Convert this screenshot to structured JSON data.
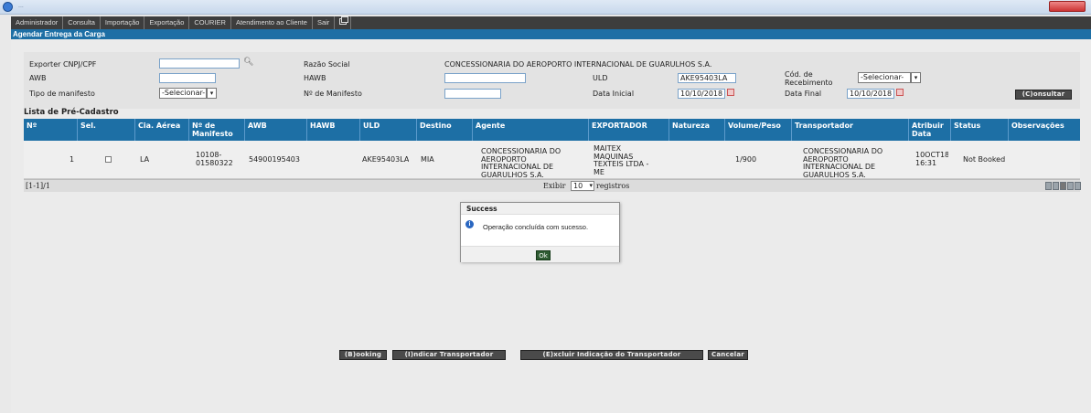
{
  "window": {
    "title": "...",
    "ie_icon": "internet-explorer-icon"
  },
  "menu": {
    "items": [
      "Administrador",
      "Consulta",
      "Importação",
      "Exportação",
      "COURIER",
      "Atendimento ao Cliente",
      "Sair"
    ],
    "extra_icon": "window-icon"
  },
  "page": {
    "title": "Agendar Entrega da Carga"
  },
  "form": {
    "exporter_label": "Exporter CNPJ/CPF",
    "exporter_value": "",
    "razao_label": "Razão Social",
    "razao_value": "CONCESSIONARIA DO AEROPORTO INTERNACIONAL DE GUARULHOS S.A.",
    "awb_label": "AWB",
    "awb_value": "",
    "hawb_label": "HAWB",
    "hawb_value": "",
    "uld_label": "ULD",
    "uld_value": "AKE95403LA",
    "cod_label_line1": "Cód. de",
    "cod_label_line2": "Recebimento",
    "cod_value": "-Selecionar-",
    "tipo_label": "Tipo de manifesto",
    "tipo_value": "-Selecionar-",
    "manifesto_label": "Nº de Manifesto",
    "manifesto_value": "",
    "data_inicial_label": "Data Inicial",
    "data_inicial_value": "10/10/2018",
    "data_final_label": "Data Final",
    "data_final_value": "10/10/2018",
    "consultar_label": "(C)onsultar"
  },
  "list": {
    "title": "Lista de Pré-Cadastro",
    "columns": [
      "Nº",
      "Sel.",
      "Cia. Aérea",
      "Nº de Manifesto",
      "AWB",
      "HAWB",
      "ULD",
      "Destino",
      "Agente",
      "EXPORTADOR",
      "Natureza",
      "Volume/Peso",
      "Transportador",
      "Atribuir Data",
      "Status",
      "Observações"
    ],
    "rows": [
      {
        "numero": "1",
        "cia": "LA",
        "manifesto": "10108-01580322",
        "awb": "54900195403",
        "hawb": "",
        "uld": "AKE95403LA",
        "destino": "MIA",
        "agente": "CONCESSIONARIA DO AEROPORTO INTERNACIONAL DE GUARULHOS S.A.",
        "exportador": "MAITEX MAQUINAS TEXTEIS LTDA - ME",
        "natureza": "",
        "volume_peso": "1/900",
        "transportador": "CONCESSIONARIA DO AEROPORTO INTERNACIONAL DE GUARULHOS S.A.",
        "atribuir_data": "10OCT18 16:31",
        "status": "Not Booked",
        "observacoes": ""
      }
    ],
    "pager": {
      "range": "[1-1]/1",
      "exibir": "Exibir",
      "page_size": "10",
      "registros": "registros"
    }
  },
  "dialog": {
    "title": "Success",
    "icon": "info-icon",
    "message": "Operação concluída com sucesso.",
    "ok": "Ok"
  },
  "actions": {
    "booking": "(B)ooking",
    "indicar": "(I)ndicar Transportador",
    "excluir": "(E)xcluir Indicação do Transportador",
    "cancelar": "Cancelar"
  }
}
